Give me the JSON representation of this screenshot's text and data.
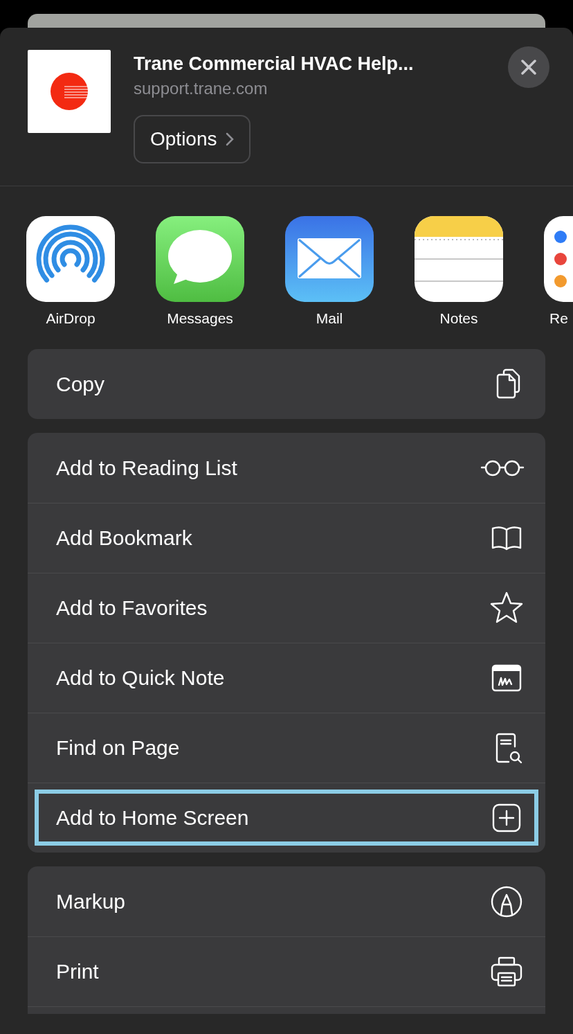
{
  "header": {
    "title": "Trane Commercial HVAC Help...",
    "subtitle": "support.trane.com",
    "options_button": "Options"
  },
  "apps": [
    {
      "kind": "airdrop",
      "label": "AirDrop"
    },
    {
      "kind": "messages",
      "label": "Messages"
    },
    {
      "kind": "mail",
      "label": "Mail"
    },
    {
      "kind": "notes",
      "label": "Notes"
    },
    {
      "kind": "reminders",
      "label": "Re"
    }
  ],
  "action_groups": [
    {
      "items": [
        {
          "kind": "copy",
          "label": "Copy",
          "highlighted": false
        }
      ]
    },
    {
      "items": [
        {
          "kind": "glasses",
          "label": "Add to Reading List",
          "highlighted": false
        },
        {
          "kind": "book",
          "label": "Add Bookmark",
          "highlighted": false
        },
        {
          "kind": "star",
          "label": "Add to Favorites",
          "highlighted": false
        },
        {
          "kind": "quicknote",
          "label": "Add to Quick Note",
          "highlighted": false
        },
        {
          "kind": "findpage",
          "label": "Find on Page",
          "highlighted": false
        },
        {
          "kind": "addsquare",
          "label": "Add to Home Screen",
          "highlighted": true
        }
      ]
    },
    {
      "items": [
        {
          "kind": "markup",
          "label": "Markup",
          "highlighted": false
        },
        {
          "kind": "print",
          "label": "Print",
          "highlighted": false
        }
      ],
      "continues": true
    }
  ]
}
